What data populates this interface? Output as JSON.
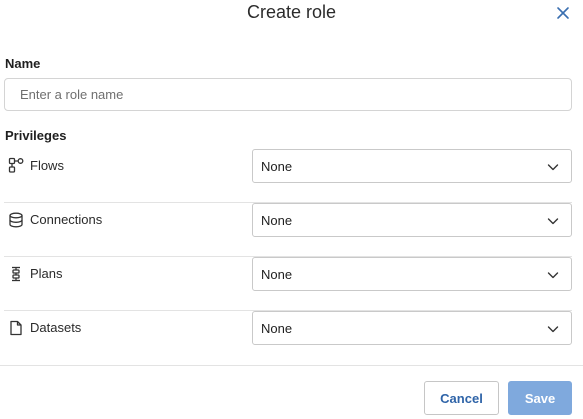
{
  "dialog": {
    "title": "Create role",
    "close_icon": "close-icon"
  },
  "name": {
    "label": "Name",
    "value": "",
    "placeholder": "Enter a role name"
  },
  "privileges": {
    "label": "Privileges",
    "items": [
      {
        "label": "Flows",
        "icon": "flow-icon",
        "value": "None"
      },
      {
        "label": "Connections",
        "icon": "database-icon",
        "value": "None"
      },
      {
        "label": "Plans",
        "icon": "plan-icon",
        "value": "None"
      },
      {
        "label": "Datasets",
        "icon": "file-icon",
        "value": "None"
      }
    ]
  },
  "footer": {
    "cancel_label": "Cancel",
    "save_label": "Save"
  },
  "colors": {
    "primary": "#2f64a8",
    "save_disabled": "#7fa9dd",
    "border": "#d4d4d4"
  }
}
